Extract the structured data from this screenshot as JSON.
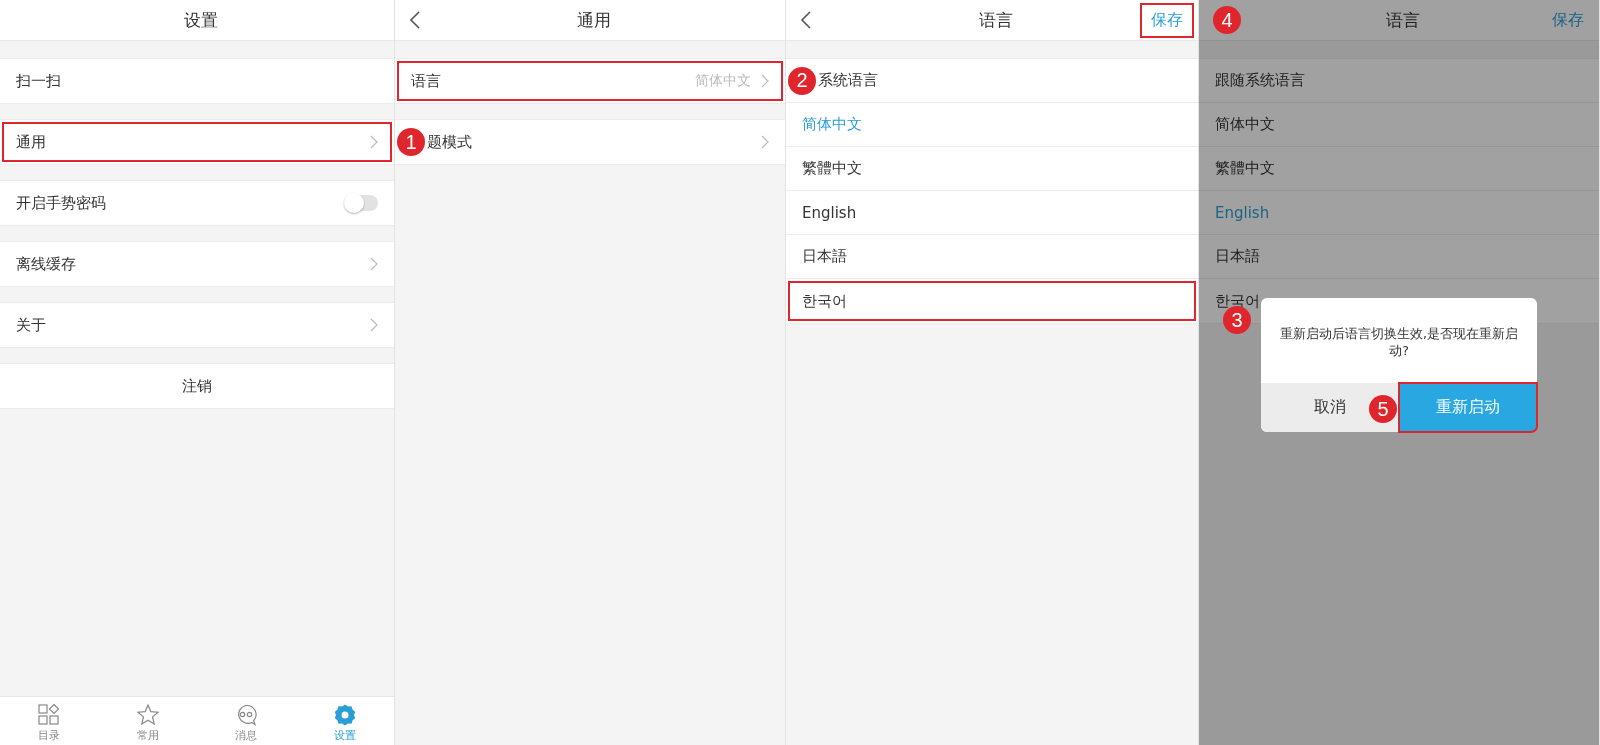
{
  "screens": [
    {
      "title": "设置",
      "groups": [
        [
          {
            "kind": "plain",
            "label": "扫一扫"
          }
        ],
        [
          {
            "kind": "link",
            "label": "通用",
            "highlighted": true
          }
        ],
        [
          {
            "kind": "switch",
            "label": "开启手势密码",
            "on": false
          }
        ],
        [
          {
            "kind": "link",
            "label": "离线缓存"
          }
        ],
        [
          {
            "kind": "link",
            "label": "关于"
          }
        ],
        [
          {
            "kind": "center",
            "label": "注销"
          }
        ]
      ],
      "tabs": [
        {
          "label": "目录",
          "selected": false
        },
        {
          "label": "常用",
          "selected": false
        },
        {
          "label": "消息",
          "selected": false
        },
        {
          "label": "设置",
          "selected": true
        }
      ]
    },
    {
      "title": "通用",
      "back": true,
      "groups": [
        [
          {
            "kind": "link",
            "label": "语言",
            "value": "简体中文",
            "highlighted": true
          }
        ],
        [
          {
            "kind": "link",
            "label": "题模式",
            "callout": "1"
          }
        ]
      ]
    },
    {
      "title": "语言",
      "back": true,
      "action": {
        "label": "保存",
        "highlighted": true
      },
      "groups": [
        [
          {
            "kind": "option",
            "label": "系统语言",
            "selected": false,
            "callout": "2"
          },
          {
            "kind": "option",
            "label": "简体中文",
            "selected": true
          },
          {
            "kind": "option",
            "label": "繁體中文",
            "selected": false
          },
          {
            "kind": "option",
            "label": "English",
            "selected": false
          },
          {
            "kind": "option",
            "label": "日本語",
            "selected": false
          },
          {
            "kind": "option",
            "label": "한국어",
            "selected": false,
            "highlighted": true
          }
        ]
      ]
    },
    {
      "title": "语言",
      "callout": "4",
      "dimmed": true,
      "action": {
        "label": "保存",
        "highlighted": false
      },
      "groups": [
        [
          {
            "kind": "option",
            "label": "跟随系统语言",
            "selected": false
          },
          {
            "kind": "option",
            "label": "简体中文",
            "selected": false
          },
          {
            "kind": "option",
            "label": "繁體中文",
            "selected": false
          },
          {
            "kind": "option",
            "label": "English",
            "selected": true
          },
          {
            "kind": "option",
            "label": "日本語",
            "selected": false
          },
          {
            "kind": "option",
            "label": "한국어",
            "selected": false
          }
        ]
      ],
      "dialog": {
        "message": "重新启动后语言切换生效,是否现在重新启动?",
        "callout": "3",
        "buttons": [
          {
            "kind": "cancel",
            "label": "取消",
            "highlighted": false
          },
          {
            "kind": "confirm",
            "label": "重新启动",
            "highlighted": true,
            "callout": "5"
          }
        ]
      }
    }
  ]
}
